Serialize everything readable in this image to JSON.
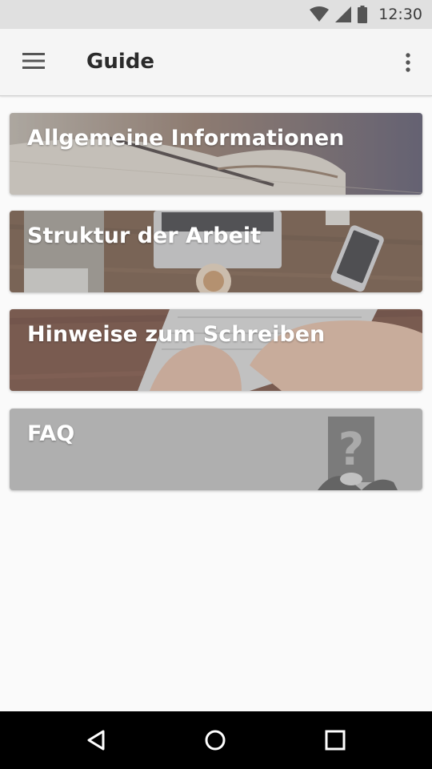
{
  "status_bar": {
    "time": "12:30",
    "icons": [
      "wifi-icon",
      "cell-signal-icon",
      "battery-icon"
    ]
  },
  "app_bar": {
    "menu_icon": "hamburger-menu-icon",
    "title": "Guide",
    "overflow_icon": "more-vert-icon"
  },
  "cards": [
    {
      "label": "Allgemeine Informationen"
    },
    {
      "label": "Struktur der Arbeit"
    },
    {
      "label": "Hinweise zum Schreiben"
    },
    {
      "label": "FAQ"
    }
  ],
  "nav_bar": {
    "icons": [
      "back-icon",
      "home-icon",
      "recents-icon"
    ]
  },
  "colors": {
    "status_bar": "#e0e0e0",
    "app_bar": "#f5f5f5",
    "background": "#fafafa",
    "nav_bar": "#000000"
  }
}
